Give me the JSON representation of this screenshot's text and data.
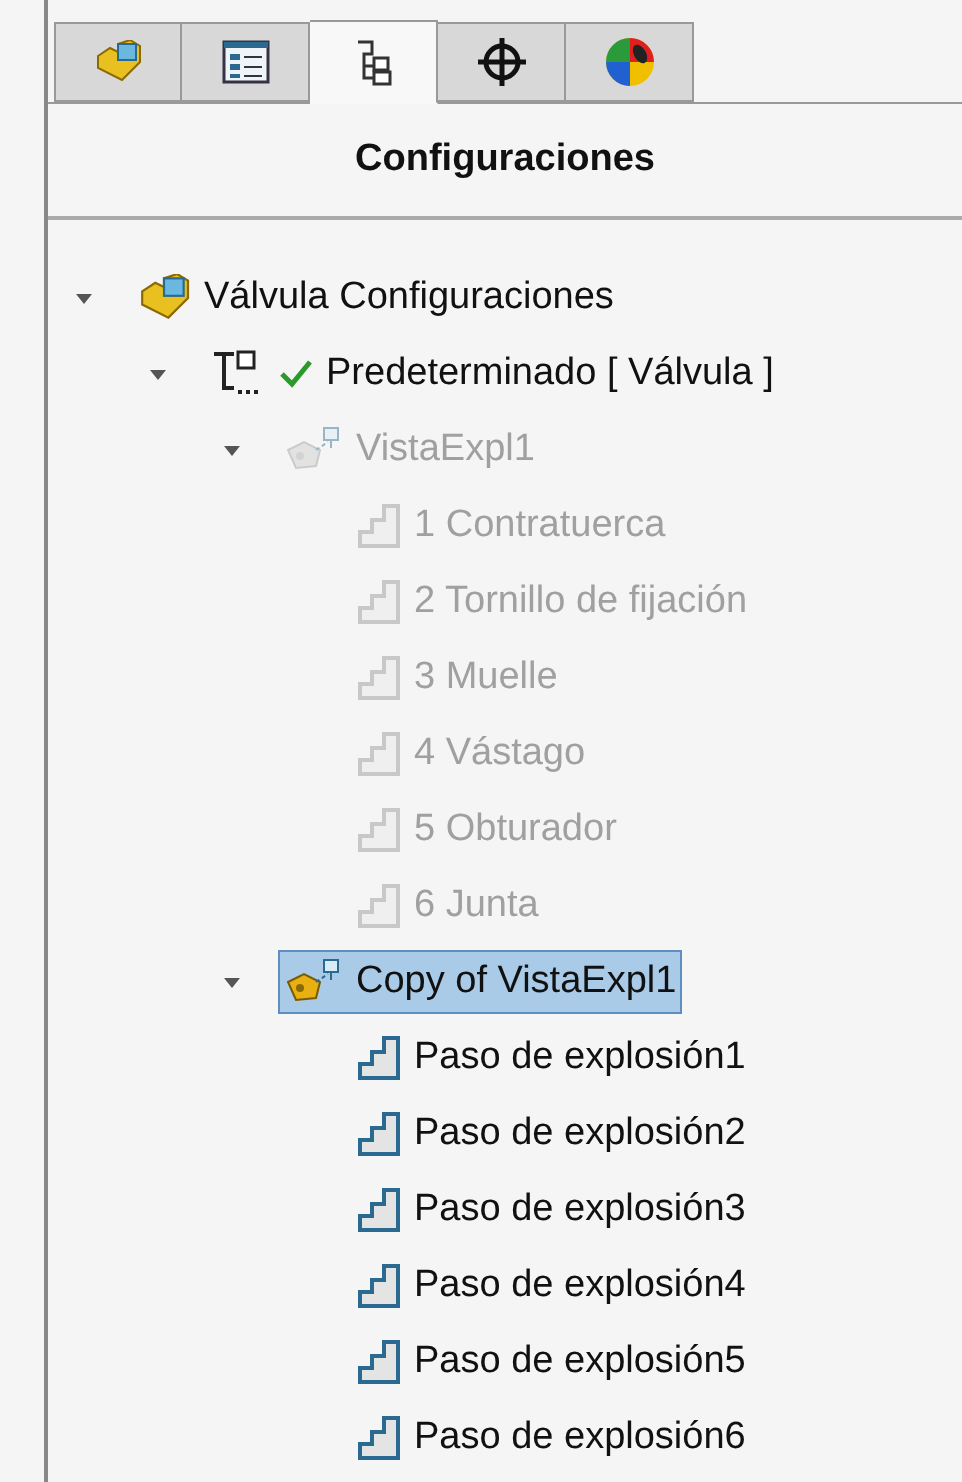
{
  "tabs": [
    {
      "kind": "feature",
      "selected": false
    },
    {
      "kind": "property",
      "selected": false
    },
    {
      "kind": "configuration",
      "selected": true
    },
    {
      "kind": "dimxpert",
      "selected": false
    },
    {
      "kind": "display",
      "selected": false
    }
  ],
  "panel": {
    "title": "Configuraciones"
  },
  "tree": [
    {
      "kind": "part",
      "label": "Válvula Configuraciones",
      "expanded": true,
      "selected": false,
      "disabled": false,
      "children": [
        {
          "kind": "configuration",
          "label": "Predeterminado [ Válvula ]",
          "active": true,
          "expanded": true,
          "selected": false,
          "disabled": false,
          "children": [
            {
              "kind": "explode-view",
              "label": "VistaExpl1",
              "expanded": true,
              "selected": false,
              "disabled": true,
              "children": [
                {
                  "kind": "step",
                  "label": "1 Contratuerca",
                  "selected": false,
                  "disabled": true
                },
                {
                  "kind": "step",
                  "label": "2 Tornillo de fijación",
                  "selected": false,
                  "disabled": true
                },
                {
                  "kind": "step",
                  "label": "3 Muelle",
                  "selected": false,
                  "disabled": true
                },
                {
                  "kind": "step",
                  "label": "4 Vástago",
                  "selected": false,
                  "disabled": true
                },
                {
                  "kind": "step",
                  "label": "5 Obturador",
                  "selected": false,
                  "disabled": true
                },
                {
                  "kind": "step",
                  "label": "6 Junta",
                  "selected": false,
                  "disabled": true
                }
              ]
            },
            {
              "kind": "explode-view",
              "label": "Copy of VistaExpl1",
              "expanded": true,
              "selected": true,
              "disabled": false,
              "children": [
                {
                  "kind": "step",
                  "label": "Paso de explosión1",
                  "selected": false,
                  "disabled": false
                },
                {
                  "kind": "step",
                  "label": "Paso de explosión2",
                  "selected": false,
                  "disabled": false
                },
                {
                  "kind": "step",
                  "label": "Paso de explosión3",
                  "selected": false,
                  "disabled": false
                },
                {
                  "kind": "step",
                  "label": "Paso de explosión4",
                  "selected": false,
                  "disabled": false
                },
                {
                  "kind": "step",
                  "label": "Paso de explosión5",
                  "selected": false,
                  "disabled": false
                },
                {
                  "kind": "step",
                  "label": "Paso de explosión6",
                  "selected": false,
                  "disabled": false
                }
              ]
            }
          ]
        }
      ]
    }
  ]
}
